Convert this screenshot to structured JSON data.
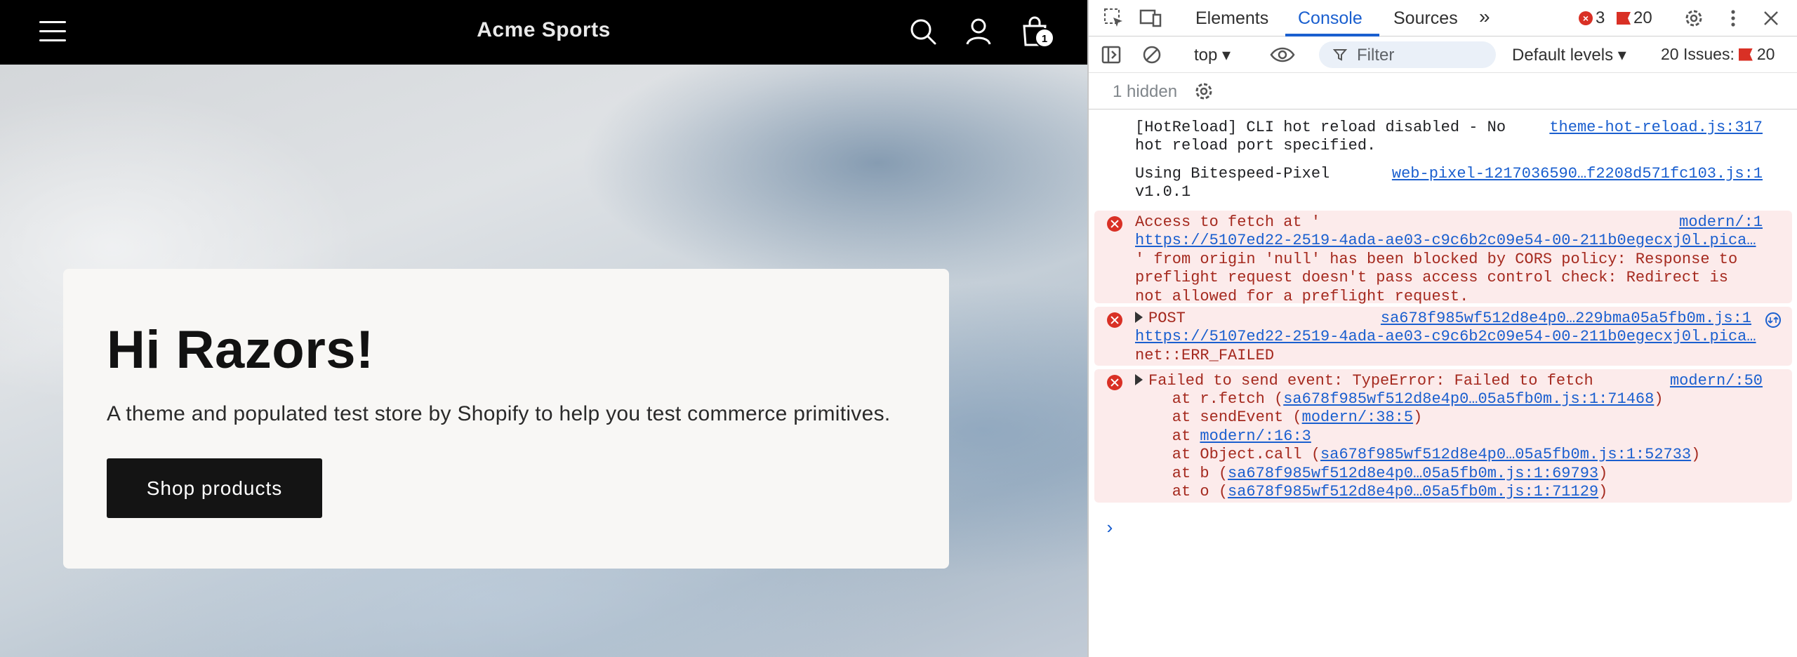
{
  "store": {
    "title": "Acme Sports",
    "cart_count": "1",
    "hero": {
      "heading": "Hi Razors!",
      "subtext": "A theme and populated test store by Shopify to help you test commerce primitives.",
      "button_label": "Shop products"
    }
  },
  "devtools": {
    "tabs": [
      "Elements",
      "Console",
      "Sources"
    ],
    "active_tab": "Console",
    "error_count": "3",
    "issue_count": "20",
    "toolbar": {
      "context": "top",
      "filter_placeholder": "Filter",
      "levels": "Default levels",
      "issues_label": "20 Issues:",
      "issues_count": "20"
    },
    "hidden_label": "1 hidden",
    "console": {
      "m1": {
        "text": "[HotReload] CLI hot reload disabled - No\nhot reload port specified.",
        "source": "theme-hot-reload.js:317"
      },
      "m2": {
        "text": "Using Bitespeed-Pixel\nv1.0.1",
        "source": "web-pixel-1217036590…f2208d571fc103.js:1"
      },
      "m3": {
        "line1": "Access to fetch at '",
        "url": "https://5107ed22-2519-4ada-ae03-c9c6b2c09e54-00-211b0egecxj0l.pica…",
        "rest": "' from origin 'null' has been blocked by CORS policy: Response to\npreflight request doesn't pass access control check: Redirect is\nnot allowed for a preflight request.",
        "source": "modern/:1"
      },
      "m4": {
        "method": "POST",
        "url": "https://5107ed22-2519-4ada-ae03-c9c6b2c09e54-00-211b0egecxj0l.pica…",
        "error": "net::ERR_FAILED",
        "source": "sa678f985wf512d8e4p0…229bma05a5fb0m.js:1"
      },
      "m5": {
        "text": "Failed to send event: TypeError: Failed to fetch",
        "source": "modern/:50",
        "stack": [
          {
            "pre": "    at r.fetch (",
            "link": "sa678f985wf512d8e4p0…05a5fb0m.js:1:71468",
            "post": ")"
          },
          {
            "pre": "    at sendEvent (",
            "link": "modern/:38:5",
            "post": ")"
          },
          {
            "pre": "    at ",
            "link": "modern/:16:3",
            "post": ""
          },
          {
            "pre": "    at Object.call (",
            "link": "sa678f985wf512d8e4p0…05a5fb0m.js:1:52733",
            "post": ")"
          },
          {
            "pre": "    at b (",
            "link": "sa678f985wf512d8e4p0…05a5fb0m.js:1:69793",
            "post": ")"
          },
          {
            "pre": "    at o (",
            "link": "sa678f985wf512d8e4p0…05a5fb0m.js:1:71129",
            "post": ")"
          }
        ]
      },
      "prompt": "›"
    }
  },
  "colors": {
    "accent": "#1a5fcf",
    "error": "#d93025",
    "error_bg": "#fcebeb"
  },
  "icons": [
    "menu-icon",
    "search-icon",
    "account-icon",
    "cart-icon",
    "inspect-icon",
    "device-toolbar-icon",
    "more-tabs-icon",
    "settings-icon",
    "kebab-icon",
    "close-icon",
    "sidebar-icon",
    "clear-icon",
    "eye-icon",
    "filter-icon",
    "gear-icon",
    "error-icon"
  ]
}
